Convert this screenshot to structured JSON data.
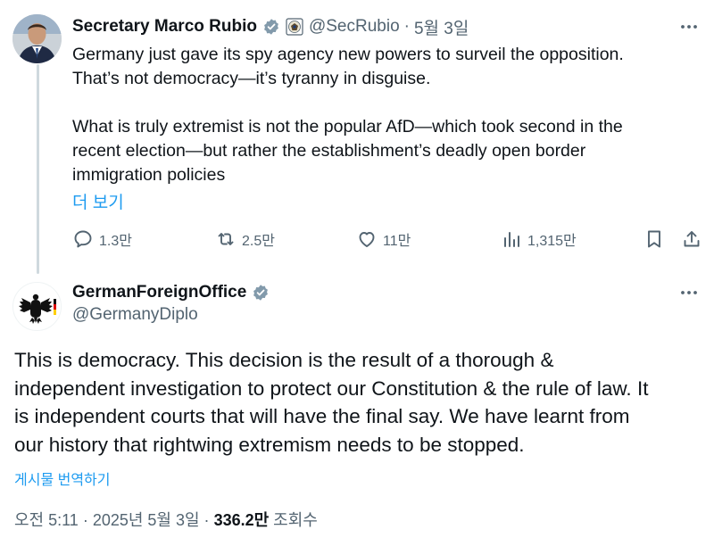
{
  "parent_tweet": {
    "name": "Secretary Marco Rubio",
    "handle": "@SecRubio",
    "separator": "·",
    "date": "5월 3일",
    "lines": [
      "Germany just gave its spy agency new powers to surveil the opposition.",
      "That’s not democracy—it’s tyranny in disguise.",
      "",
      "What is truly extremist is not the popular AfD—which took second in the",
      "recent election—but rather the establishment’s deadly open border",
      "immigration policies"
    ],
    "show_more": "더 보기",
    "stats": {
      "replies": "1.3만",
      "reposts": "2.5만",
      "likes": "11만",
      "views": "1,315만"
    }
  },
  "main_tweet": {
    "name": "GermanForeignOffice",
    "handle": "@GermanyDiplo",
    "lines": [
      "This is democracy. This decision is the result of a thorough &",
      "independent investigation to protect our Constitution & the rule of law. It",
      "is independent courts that will have the final say. We have learnt from",
      "our history that rightwing extremism needs to be stopped."
    ],
    "translate": "게시물 번역하기",
    "timestamp": "오전 5:11 · 2025년 5월 3일 · ",
    "views_count": "336.2만",
    "views_label": " 조회수"
  },
  "colors": {
    "text": "#0f1419",
    "secondary": "#536471",
    "link": "#1d9bf0",
    "verified": "#829aab",
    "thread_line": "#cfd9de"
  },
  "icons": {
    "verified": "verified-badge-icon",
    "government": "government-seal-icon",
    "more": "more-dots-icon",
    "reply": "reply-bubble-icon",
    "repost": "repost-icon",
    "like": "heart-icon",
    "views": "views-bars-icon",
    "bookmark": "bookmark-icon",
    "share": "share-upload-icon",
    "eagle": "federal-eagle-icon"
  }
}
